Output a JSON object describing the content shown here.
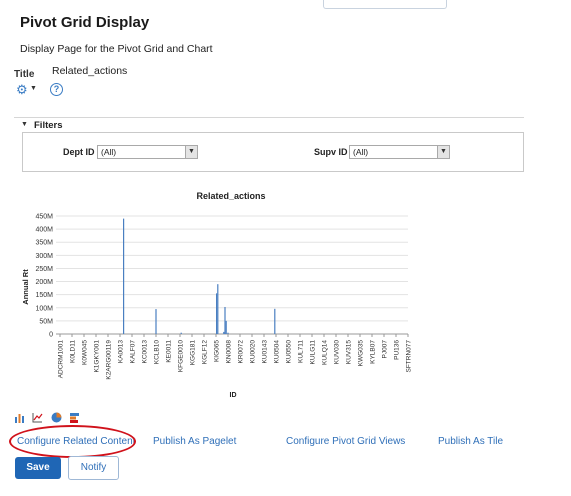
{
  "page": {
    "title": "Pivot Grid Display",
    "description": "Display Page for the Pivot Grid and Chart",
    "title_label": "Title",
    "title_value": "Related_actions"
  },
  "icons": {
    "gear": "gear-icon",
    "help": "help-icon"
  },
  "filters": {
    "label": "Filters",
    "dept": {
      "label": "Dept ID",
      "value": "(All)"
    },
    "supv": {
      "label": "Supv ID",
      "value": "(All)"
    }
  },
  "chart_data": {
    "type": "bar",
    "title": "Related_actions",
    "xlabel": "ID",
    "ylabel": "Annual Rt",
    "ylim": [
      0,
      450000000
    ],
    "yticks": [
      "0",
      "50M",
      "100M",
      "150M",
      "200M",
      "250M",
      "300M",
      "350M",
      "400M",
      "450M"
    ],
    "xtick_labels": [
      "ADCRM1001",
      "K0LD11",
      "K0W045",
      "K1GKY001",
      "K2ARG00119",
      "KA0013",
      "KALF07",
      "KC0013",
      "KCLB10",
      "KE0011",
      "KFGE0010",
      "KGG181",
      "KGLF12",
      "KIG065",
      "KN0008",
      "KR0072",
      "KU0020",
      "KU0143",
      "KU0504",
      "KU0550",
      "KUL711",
      "KULG11",
      "KULQ14",
      "KUV030",
      "KUV315",
      "KWG035",
      "KYLB07",
      "PJ007",
      "PU136",
      "SFTRN077"
    ],
    "bars": [
      {
        "x": 5.3,
        "value": 440000000
      },
      {
        "x": 8.0,
        "value": 95000000
      },
      {
        "x": 10.1,
        "value": 5000000
      },
      {
        "x": 13.05,
        "value": 155000000
      },
      {
        "x": 13.15,
        "value": 190000000
      },
      {
        "x": 13.65,
        "value": 8000000
      },
      {
        "x": 13.75,
        "value": 103000000
      },
      {
        "x": 13.85,
        "value": 50000000
      },
      {
        "x": 14.0,
        "value": 5000000
      },
      {
        "x": 17.9,
        "value": 96000000
      }
    ],
    "bar_color": "#4a7fc1",
    "grid": true
  },
  "tool_icons": [
    "bar-chart-icon",
    "line-chart-icon",
    "pie-chart-icon",
    "stacked-bar-icon"
  ],
  "links": {
    "configure_related": "Configure Related Content",
    "publish_pagelet": "Publish As Pagelet",
    "configure_pivot": "Configure Pivot Grid Views",
    "publish_tile": "Publish As Tile"
  },
  "buttons": {
    "save": "Save",
    "notify": "Notify"
  },
  "colors": {
    "accent": "#1f66b5",
    "link": "#2f6fb8",
    "highlight": "#d0121b"
  }
}
